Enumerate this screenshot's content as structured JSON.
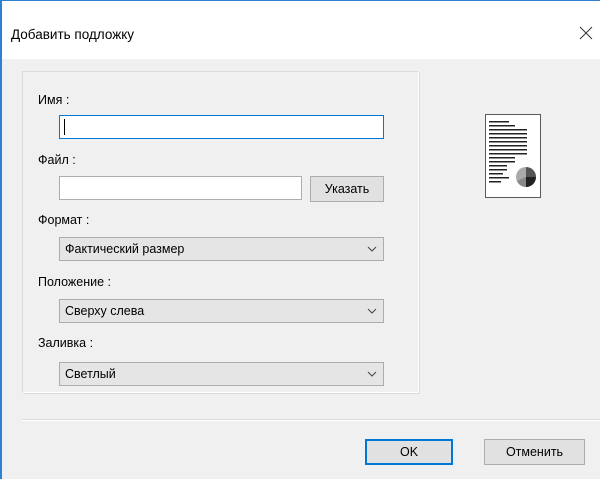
{
  "window": {
    "title": "Добавить подложку",
    "close_icon": "close-icon"
  },
  "form": {
    "name_label": "Имя :",
    "name_value": "",
    "file_label": "Файл :",
    "file_value": "",
    "browse_label": "Указать",
    "format_label": "Формат :",
    "format_value": "Фактический размер",
    "position_label": "Положение :",
    "position_value": "Сверху слева",
    "fill_label": "Заливка :",
    "fill_value": "Светлый"
  },
  "preview": {
    "icon": "page-preview-icon"
  },
  "footer": {
    "ok_label": "OK",
    "cancel_label": "Отменить"
  },
  "colors": {
    "accent": "#0078d7",
    "window_border": "#2f7fd3",
    "dialog_bg": "#f0f0f0"
  }
}
